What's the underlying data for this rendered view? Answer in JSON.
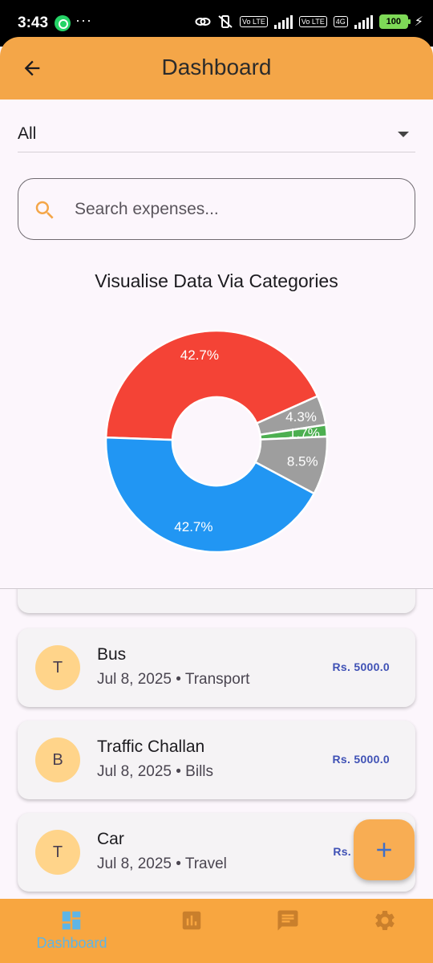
{
  "status_bar": {
    "time": "3:43",
    "battery": "100",
    "network_tags": [
      "Vo LTE",
      "Vo LTE",
      "4G"
    ]
  },
  "app_bar": {
    "title": "Dashboard",
    "back_icon": "arrow-back-icon"
  },
  "filter": {
    "selected": "All"
  },
  "search": {
    "placeholder": "Search expenses...",
    "value": ""
  },
  "chart": {
    "title": "Visualise Data Via Categories"
  },
  "chart_data": {
    "type": "pie",
    "donut": true,
    "title": "Visualise Data Via Categories",
    "slices": [
      {
        "value": 42.7,
        "label": "42.7%",
        "color": "#F44336"
      },
      {
        "value": 4.3,
        "label": "4.3%",
        "color": "#9E9E9E"
      },
      {
        "value": 1.7,
        "label": "1.7%",
        "color": "#4CAF50"
      },
      {
        "value": 8.5,
        "label": "8.5%",
        "color": "#9E9E9E"
      },
      {
        "value": 42.7,
        "label": "42.7%",
        "color": "#2196F3"
      }
    ]
  },
  "expenses": [
    {
      "initial": "T",
      "title": "Bus",
      "subtitle": "Jul 8, 2025 • Transport",
      "amount": "Rs. 5000.0"
    },
    {
      "initial": "B",
      "title": "Traffic Challan",
      "subtitle": "Jul 8, 2025 • Bills",
      "amount": "Rs. 5000.0"
    },
    {
      "initial": "T",
      "title": "Car",
      "subtitle": "Jul 8, 2025 • Travel",
      "amount": "Rs."
    }
  ],
  "fab": {
    "icon": "plus-icon"
  },
  "bottom_nav": {
    "items": [
      {
        "label": "Dashboard",
        "icon": "dashboard-icon",
        "active": true
      },
      {
        "label": "",
        "icon": "bar-chart-icon",
        "active": false
      },
      {
        "label": "",
        "icon": "chat-icon",
        "active": false
      },
      {
        "label": "",
        "icon": "settings-icon",
        "active": false
      }
    ]
  },
  "colors": {
    "primary": "#F4A648",
    "avatar": "#FFD48A",
    "amount": "#3F51B5",
    "nav_active": "#5EB5E6",
    "nav_inactive": "#C97F2C"
  }
}
